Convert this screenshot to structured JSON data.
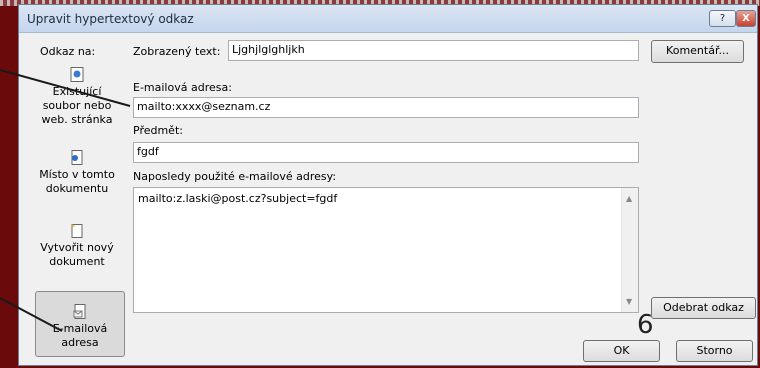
{
  "dialog": {
    "title": "Upravit hypertextový odkaz",
    "help_label": "?",
    "close_label": "X"
  },
  "sidebar": {
    "link_to_label": "Odkaz na:",
    "items": [
      {
        "label_lines": [
          "Existující",
          "soubor nebo",
          "web. stránka"
        ],
        "icon": "web-page-icon",
        "selected": false
      },
      {
        "label_lines": [
          "Místo v tomto",
          "dokumentu"
        ],
        "icon": "document-place-icon",
        "selected": false
      },
      {
        "label_lines": [
          "Vytvořit nový",
          "dokument"
        ],
        "icon": "new-document-icon",
        "selected": false
      },
      {
        "label_lines": [
          "E-mailová",
          "adresa"
        ],
        "icon": "email-icon",
        "selected": true
      }
    ]
  },
  "display_text": {
    "label": "Zobrazený text:",
    "value": "Ljghjlglghljkh",
    "comment_button": "Komentář..."
  },
  "email": {
    "address_label": "E-mailová adresa:",
    "address_value": "mailto:xxxx@seznam.cz",
    "subject_label": "Předmět:",
    "subject_value": "fgdf",
    "recent_label": "Naposledy použité e-mailové adresy:",
    "recent_items": [
      "mailto:z.laski@post.cz?subject=fgdf"
    ]
  },
  "buttons": {
    "remove_link": "Odebrat odkaz",
    "ok": "OK",
    "cancel": "Storno"
  },
  "annotation": {
    "number": "6"
  },
  "colors": {
    "background": "#6a0a0a",
    "annotation_line": "#1a1a1a"
  }
}
